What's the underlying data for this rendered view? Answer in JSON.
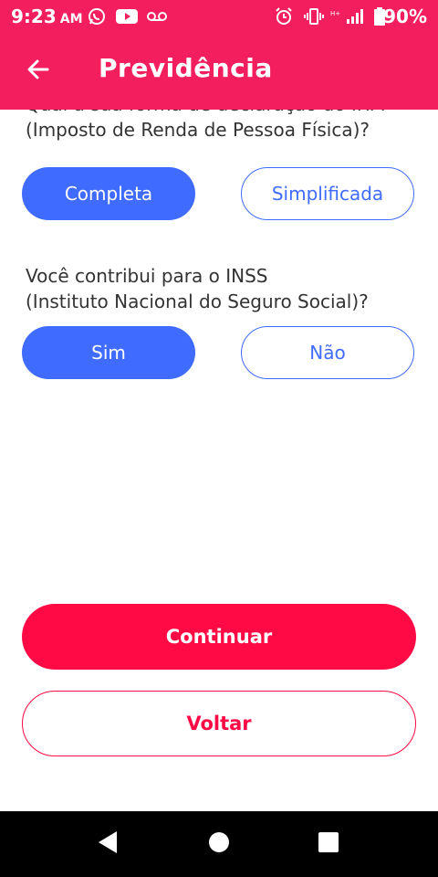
{
  "status_bar": {
    "time": "9:23",
    "ampm": "AM",
    "battery": "90%",
    "icons": [
      "whatsapp-icon",
      "youtube-icon",
      "voicemail-icon",
      "alarm-icon",
      "vibrate-icon",
      "signal-icon",
      "battery-icon"
    ]
  },
  "header": {
    "title": "Previdência",
    "back_icon": "arrow-left-icon"
  },
  "questions": {
    "irpf": {
      "text_partial": "Qual a sua forma de declaração do IRPF",
      "text_line2": "(Imposto de Renda de Pessoa Física)?",
      "options": [
        "Completa",
        "Simplificada"
      ],
      "selected": "Completa"
    },
    "inss": {
      "text_line1": "Você contribui para o INSS",
      "text_line2": "(Instituto Nacional do Seguro Social)?",
      "options": [
        "Sim",
        "Não"
      ],
      "selected": "Sim"
    }
  },
  "actions": {
    "continue_label": "Continuar",
    "back_label": "Voltar"
  },
  "colors": {
    "brand": "#f31e5d",
    "primary_button": "#ff0a45",
    "selected_option": "#3f6bff"
  },
  "nav_bar": {
    "icons": [
      "back-triangle-icon",
      "home-circle-icon",
      "recents-square-icon"
    ]
  }
}
